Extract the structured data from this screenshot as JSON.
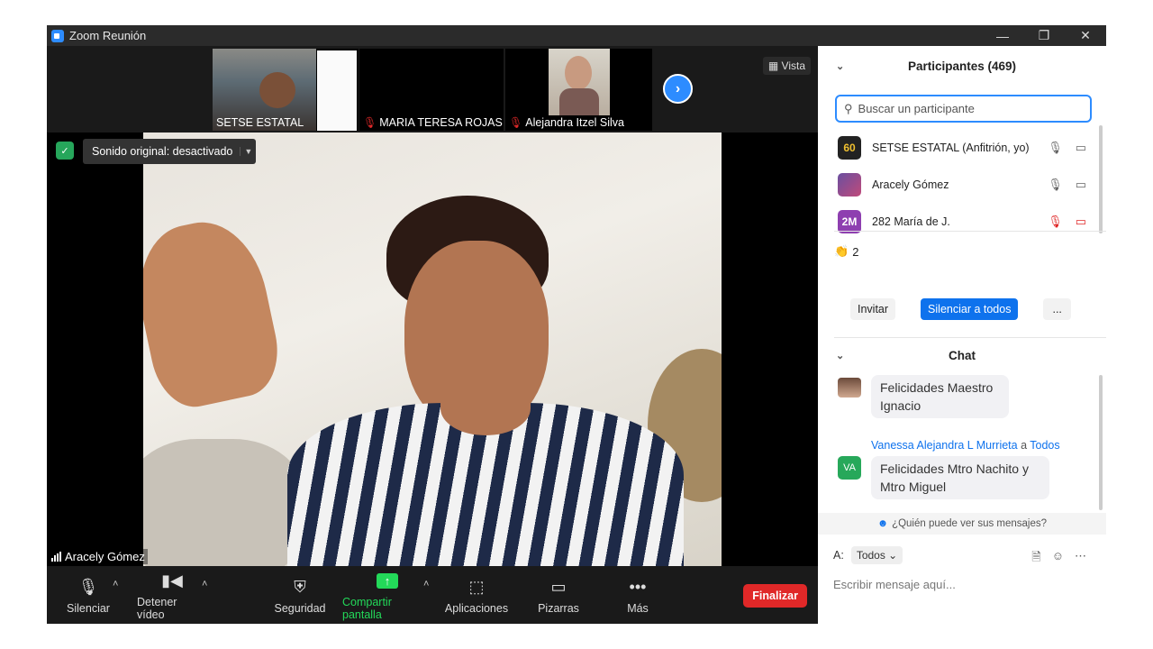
{
  "window": {
    "title": "Zoom Reunión",
    "controls": [
      "minimize-icon",
      "restore-icon",
      "close-icon"
    ]
  },
  "strip": {
    "thumbnails": [
      {
        "name": "SETSE ESTATAL",
        "muted": false
      },
      {
        "name": "MARIA TERESA ROJAS",
        "muted": true
      },
      {
        "name": "Alejandra Itzel Silva",
        "muted": true
      }
    ],
    "next_icon": "chevron-right-icon",
    "view_label": "Vista"
  },
  "video": {
    "original_sound": "Sonido original: desactivado",
    "speaker_name": "Aracely Gómez"
  },
  "toolbar": {
    "mute": "Silenciar",
    "stop_video": "Detener vídeo",
    "security": "Seguridad",
    "share": "Compartir pantalla",
    "apps": "Aplicaciones",
    "whiteboards": "Pizarras",
    "more": "Más",
    "end": "Finalizar",
    "share_color": "#23d959",
    "end_color": "#e02828"
  },
  "participants": {
    "header": "Participantes (469)",
    "search_placeholder": "Buscar un participante",
    "list": [
      {
        "avatar": "60",
        "name": "SETSE ESTATAL (Anfitrión, yo)",
        "muted": false
      },
      {
        "avatar": "",
        "name": "Aracely Gómez",
        "muted": false
      },
      {
        "avatar": "2M",
        "name": "282 María de J.",
        "muted": true
      }
    ],
    "reactions": "2",
    "invite": "Invitar",
    "mute_all": "Silenciar a todos",
    "more": "..."
  },
  "chat": {
    "header": "Chat",
    "messages": [
      {
        "text": "Felicidades Maestro Ignacio"
      },
      {
        "sender": "Vanessa Alejandra L Murrieta",
        "joiner": "a",
        "to": "Todos",
        "avatar": "VA",
        "text": "Felicidades Mtro Nachito y Mtro Miguel"
      }
    ],
    "who_can_see": "¿Quién puede ver sus mensajes?",
    "to_label": "A:",
    "to_value": "Todos",
    "compose_placeholder": "Escribir mensaje aquí..."
  }
}
